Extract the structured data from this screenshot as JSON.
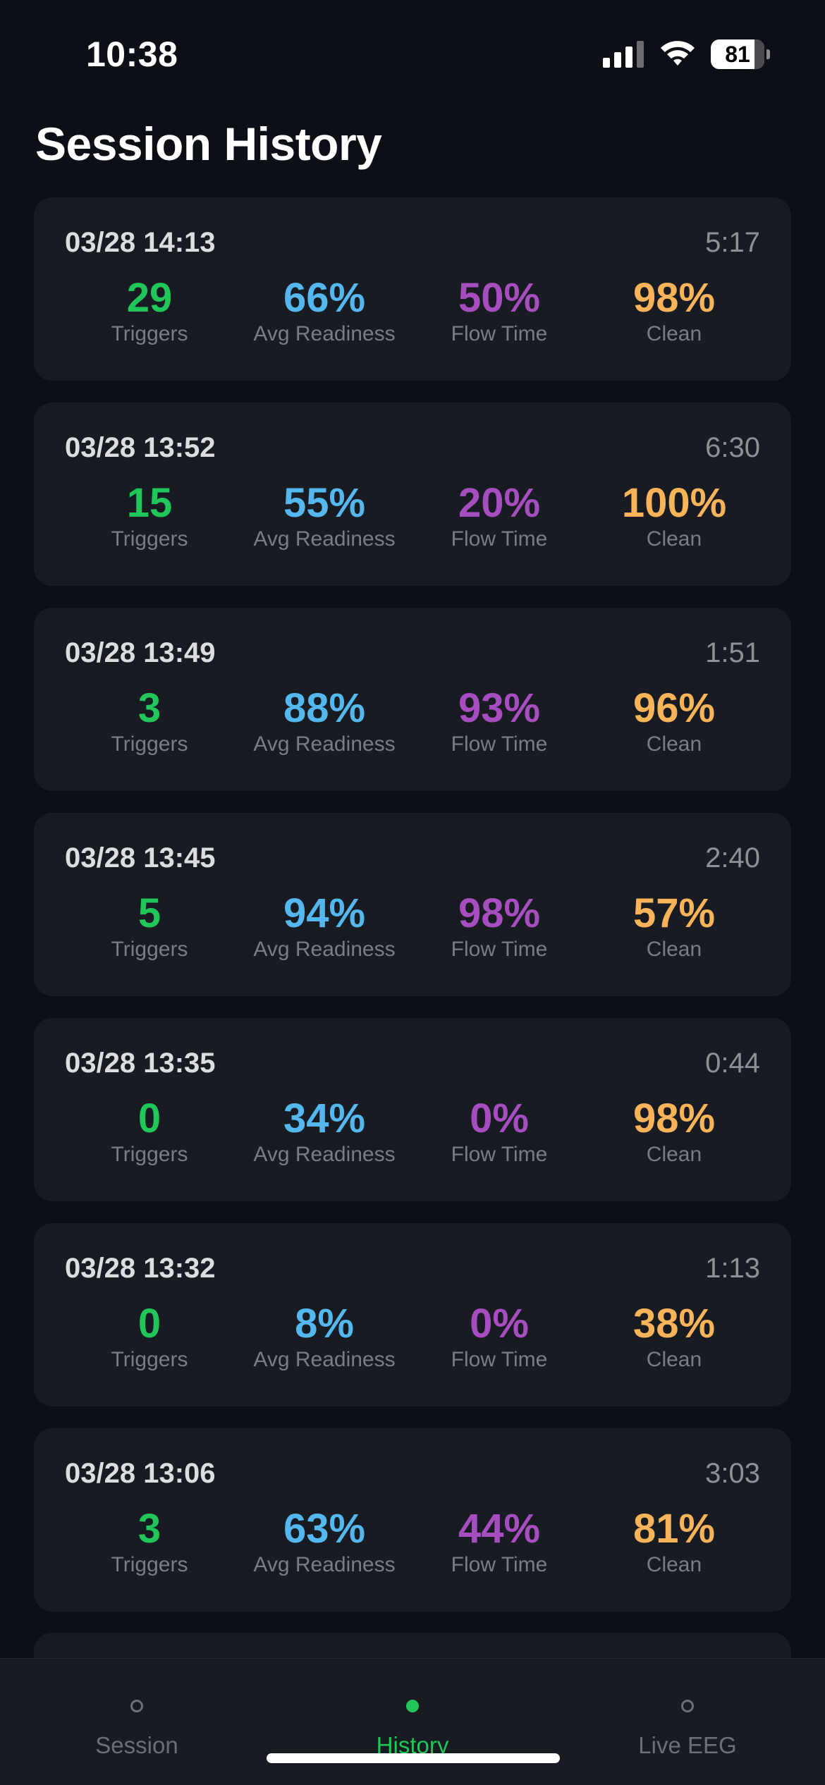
{
  "status_bar": {
    "time": "10:38",
    "battery_level": "81",
    "icons": [
      "signal-icon",
      "wifi-icon",
      "battery-icon"
    ]
  },
  "page": {
    "title": "Session History"
  },
  "colors": {
    "triggers": "#20c65a",
    "avg_readiness": "#54b8ee",
    "flow_time": "#a64dc0",
    "clean": "#f9b45a",
    "active_tab": "#20c65a"
  },
  "sessions": [
    {
      "date": "03/28 14:13",
      "duration": "5:17",
      "triggers": "29",
      "avg_readiness": "66%",
      "flow_time": "50%",
      "clean": "98%"
    },
    {
      "date": "03/28 13:52",
      "duration": "6:30",
      "triggers": "15",
      "avg_readiness": "55%",
      "flow_time": "20%",
      "clean": "100%"
    },
    {
      "date": "03/28 13:49",
      "duration": "1:51",
      "triggers": "3",
      "avg_readiness": "88%",
      "flow_time": "93%",
      "clean": "96%"
    },
    {
      "date": "03/28 13:45",
      "duration": "2:40",
      "triggers": "5",
      "avg_readiness": "94%",
      "flow_time": "98%",
      "clean": "57%"
    },
    {
      "date": "03/28 13:35",
      "duration": "0:44",
      "triggers": "0",
      "avg_readiness": "34%",
      "flow_time": "0%",
      "clean": "98%"
    },
    {
      "date": "03/28 13:32",
      "duration": "1:13",
      "triggers": "0",
      "avg_readiness": "8%",
      "flow_time": "0%",
      "clean": "38%"
    },
    {
      "date": "03/28 13:06",
      "duration": "3:03",
      "triggers": "3",
      "avg_readiness": "63%",
      "flow_time": "44%",
      "clean": "81%"
    }
  ],
  "labels": {
    "triggers": "Triggers",
    "avg_readiness": "Avg Readiness",
    "flow_time": "Flow Time",
    "clean": "Clean"
  },
  "tabs": [
    {
      "label": "Session",
      "active": false
    },
    {
      "label": "History",
      "active": true
    },
    {
      "label": "Live EEG",
      "active": false
    }
  ]
}
